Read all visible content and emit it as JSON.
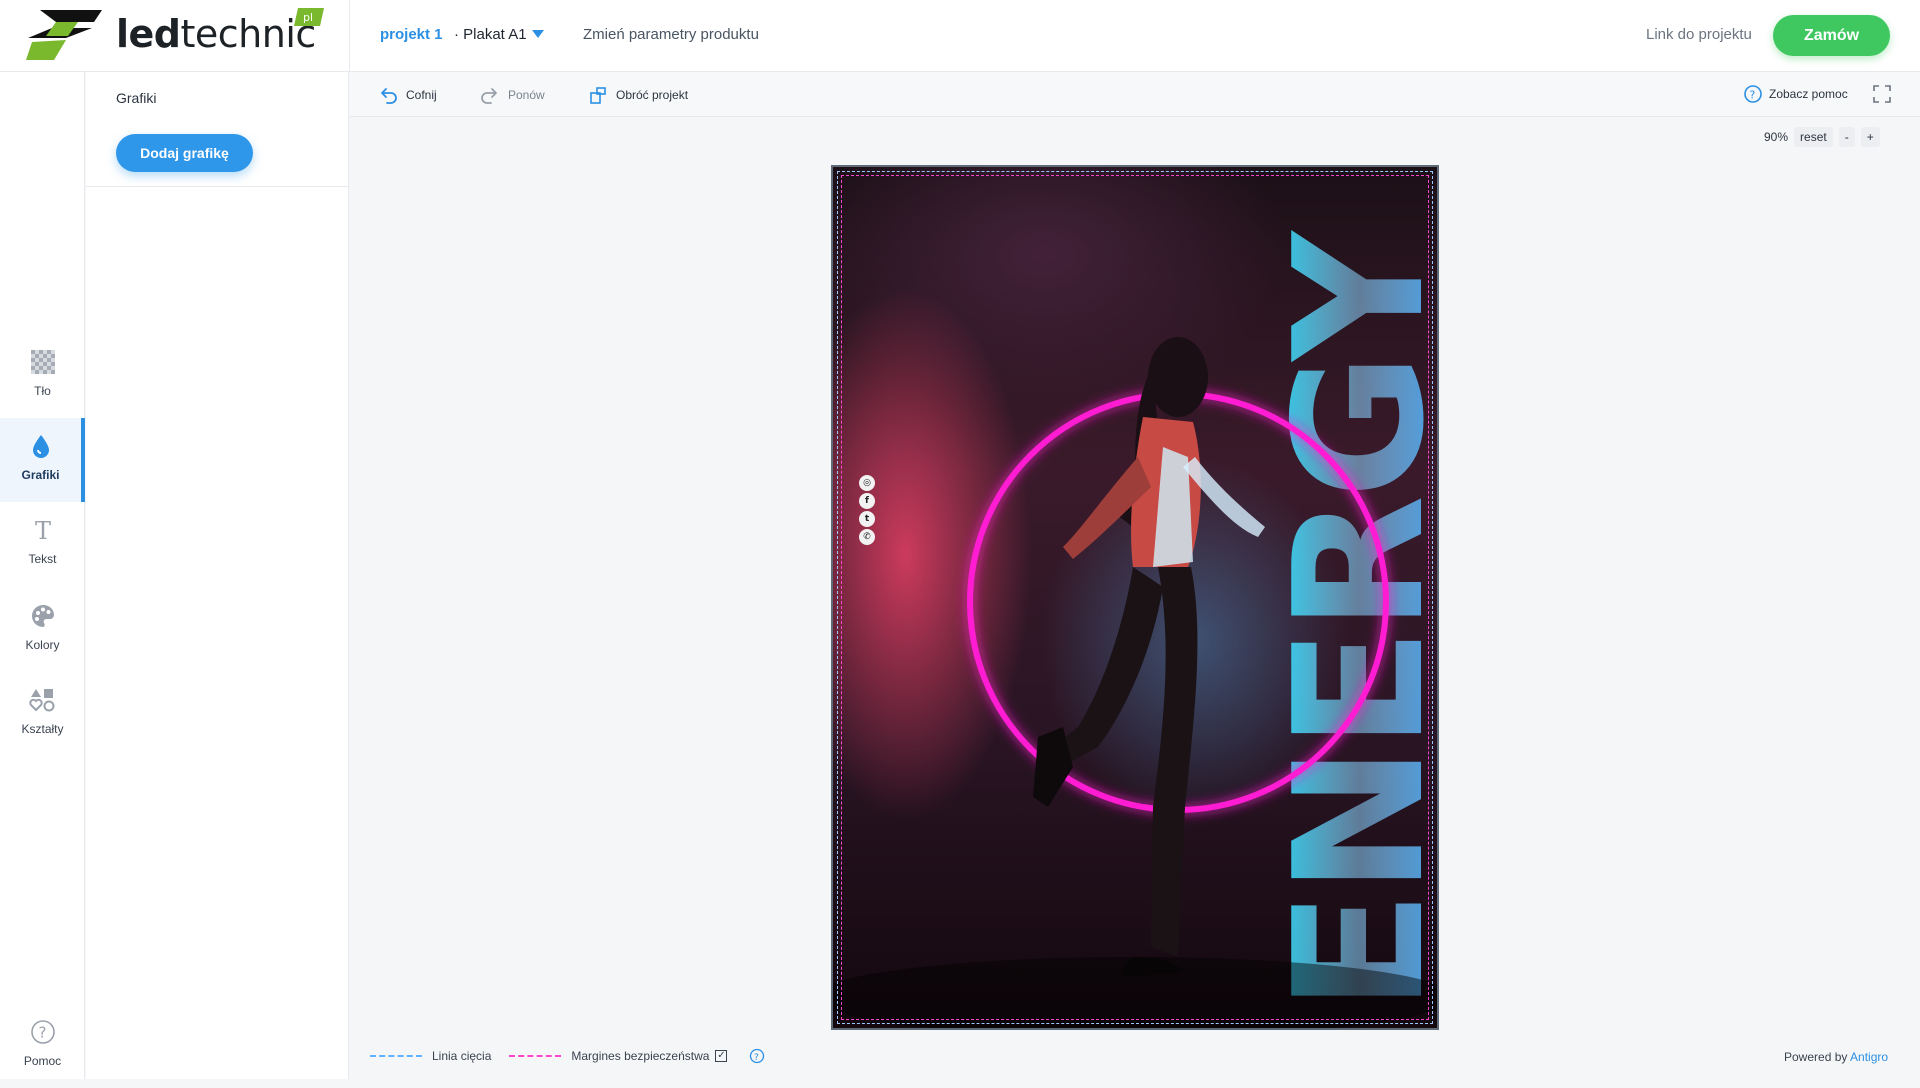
{
  "brand": {
    "name_bold": "led",
    "name_rest": "technic",
    "badge": "pl",
    "primary_color": "#1d2226",
    "accent_green": "#7ab82e"
  },
  "header": {
    "project_name": "projekt 1",
    "product": "· Plakat A1",
    "change_params": "Zmień parametry produktu",
    "link_project": "Link do projektu",
    "order_label": "Zamów"
  },
  "leftnav": {
    "items": [
      {
        "label": "Tło",
        "icon": "background-checker-icon"
      },
      {
        "label": "Grafiki",
        "icon": "drop-icon",
        "active": true
      },
      {
        "label": "Tekst",
        "icon": "text-T-icon"
      },
      {
        "label": "Kolory",
        "icon": "palette-icon"
      },
      {
        "label": "Kształty",
        "icon": "shapes-icon"
      }
    ],
    "help": {
      "label": "Pomoc",
      "icon": "question-icon"
    }
  },
  "sidepanel": {
    "title": "Grafiki",
    "add_button": "Dodaj grafikę"
  },
  "toolbar": {
    "undo": "Cofnij",
    "redo": "Ponów",
    "rotate": "Obróć projekt",
    "help": "Zobacz pomoc"
  },
  "zoom": {
    "level": "90%",
    "reset": "reset",
    "minus": "-",
    "plus": "+"
  },
  "poster": {
    "headline": "ENERGY",
    "social": [
      "◎",
      "f",
      "t",
      "✆"
    ]
  },
  "legend": {
    "cut_line": "Linia cięcia",
    "safety_margin": "Margines bezpieczeństwa",
    "safety_checked": "✓"
  },
  "footer": {
    "powered_by": "Powered by",
    "powered_brand": "Antigro"
  },
  "colors": {
    "accent_blue": "#2b90e4",
    "order_green": "#3fc85f",
    "neon_pink": "#ff1fd2",
    "neon_cyan": "#17e3ff"
  }
}
